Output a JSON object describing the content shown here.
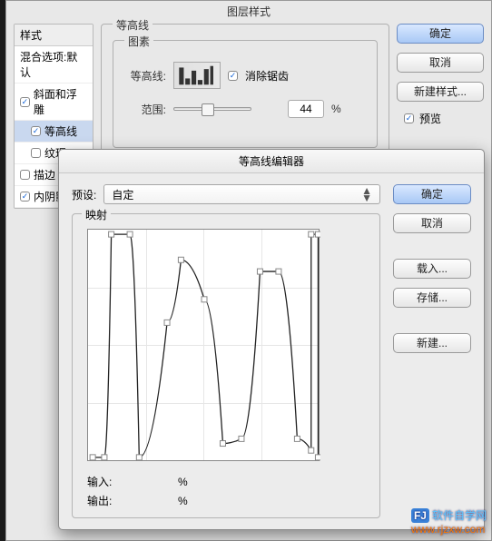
{
  "layer_style": {
    "title": "图层样式",
    "styles_header": "样式",
    "blend_options": "混合选项:默认",
    "items": [
      {
        "label": "斜面和浮雕",
        "checked": true,
        "indent": 0
      },
      {
        "label": "等高线",
        "checked": true,
        "indent": 1,
        "selected": true
      },
      {
        "label": "纹理",
        "checked": false,
        "indent": 1
      },
      {
        "label": "描边",
        "checked": false,
        "indent": 0
      },
      {
        "label": "内阴影",
        "checked": true,
        "indent": 0,
        "truncated": true
      }
    ],
    "contour_panel": {
      "title": "等高线",
      "elements_title": "图素",
      "contour_label": "等高线:",
      "antialias_label": "消除锯齿",
      "antialias_checked": true,
      "range_label": "范围:",
      "range_value": "44",
      "range_unit": "%"
    },
    "buttons": {
      "ok": "确定",
      "cancel": "取消",
      "new_style": "新建样式...",
      "preview": "预览",
      "preview_checked": true
    }
  },
  "contour_editor": {
    "title": "等高线编辑器",
    "preset_label": "预设:",
    "preset_value": "自定",
    "mapping_label": "映射",
    "input_label": "输入:",
    "input_value": "",
    "output_label": "输出:",
    "output_value": "",
    "percent": "%",
    "buttons": {
      "ok": "确定",
      "cancel": "取消",
      "load": "载入...",
      "save": "存储...",
      "new": "新建..."
    },
    "curve_points": [
      [
        0.02,
        0.02
      ],
      [
        0.07,
        0.02
      ],
      [
        0.1,
        0.98
      ],
      [
        0.18,
        0.98
      ],
      [
        0.22,
        0.02
      ],
      [
        0.34,
        0.6
      ],
      [
        0.4,
        0.87
      ],
      [
        0.5,
        0.7
      ],
      [
        0.58,
        0.08
      ],
      [
        0.66,
        0.1
      ],
      [
        0.74,
        0.82
      ],
      [
        0.82,
        0.82
      ],
      [
        0.9,
        0.1
      ],
      [
        0.96,
        0.05
      ],
      [
        0.96,
        0.98
      ],
      [
        0.99,
        0.98
      ],
      [
        0.99,
        0.02
      ]
    ]
  },
  "watermark": {
    "brand": "软件自学网",
    "url": "www.rjzxw.com"
  }
}
